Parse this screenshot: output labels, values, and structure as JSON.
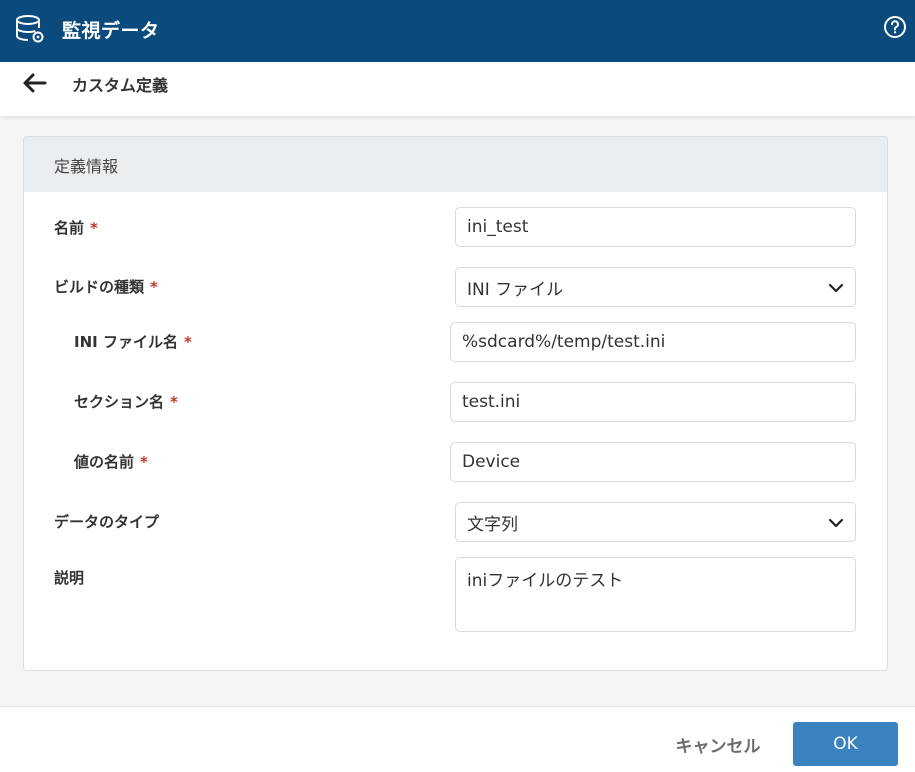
{
  "header": {
    "title": "監視データ",
    "app_icon": "database-gear-icon",
    "help_icon": "help-circle-icon"
  },
  "subheader": {
    "back_icon": "arrow-left-icon",
    "title": "カスタム定義"
  },
  "card": {
    "title": "定義情報",
    "fields": {
      "name": {
        "label": "名前",
        "required": "*",
        "value": "ini_test"
      },
      "build_type": {
        "label": "ビルドの種類",
        "required": "*",
        "value": "INI ファイル"
      },
      "ini_file_name": {
        "label": "INI ファイル名",
        "required": "*",
        "value": "%sdcard%/temp/test.ini"
      },
      "section_name": {
        "label": "セクション名",
        "required": "*",
        "value": "test.ini"
      },
      "value_name": {
        "label": "値の名前",
        "required": "*",
        "value": "Device"
      },
      "data_type": {
        "label": "データのタイプ",
        "value": "文字列"
      },
      "description": {
        "label": "説明",
        "value": "iniファイルのテスト"
      }
    }
  },
  "footer": {
    "cancel_label": "キャンセル",
    "ok_label": "OK"
  },
  "colors": {
    "header_bg": "#0b4a7d",
    "accent": "#3b82c0",
    "required": "#c0392b"
  }
}
